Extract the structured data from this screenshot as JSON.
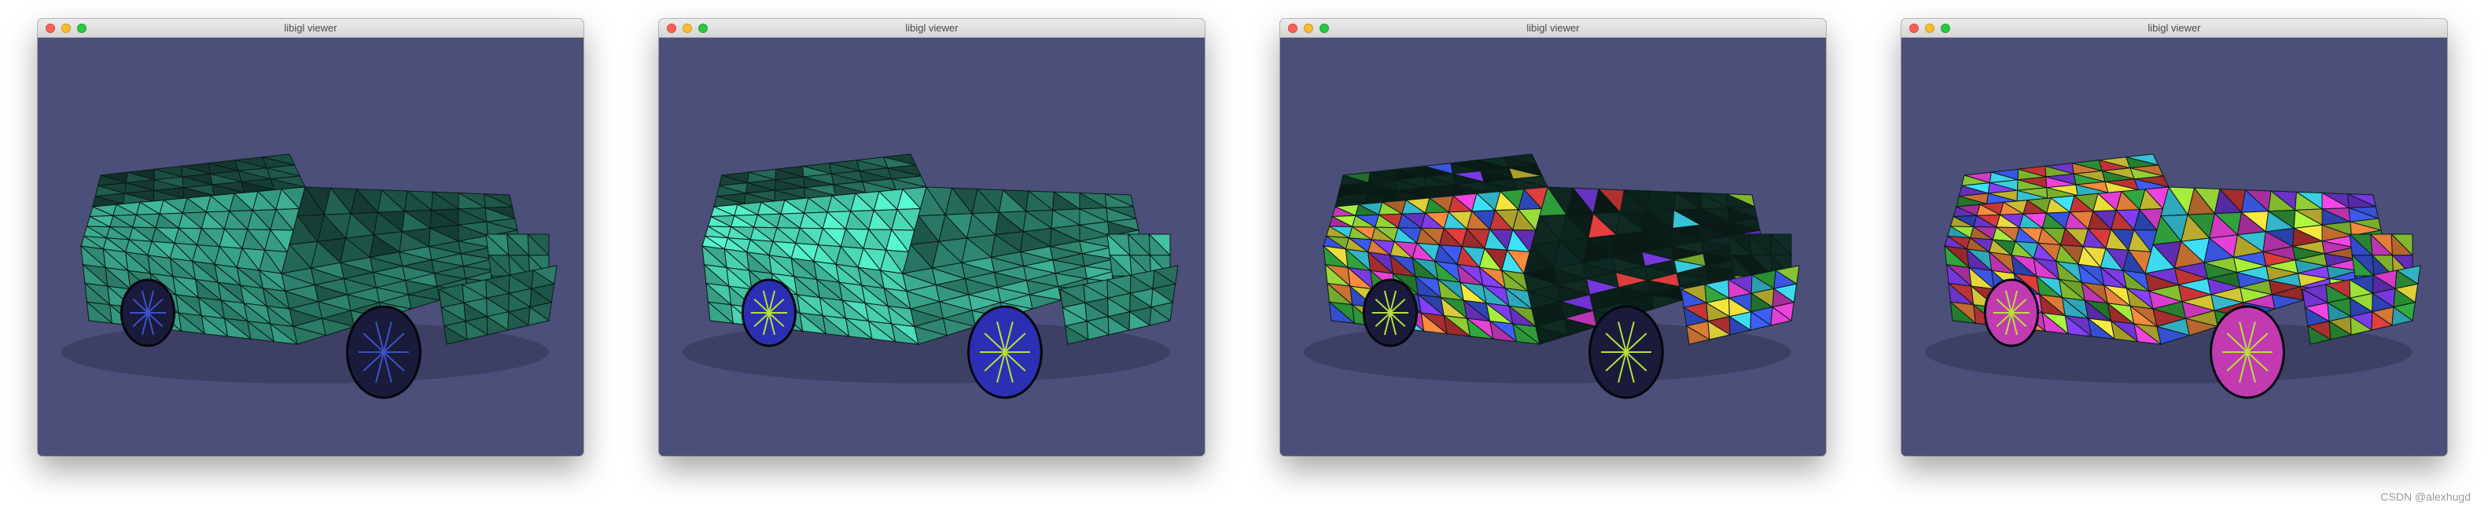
{
  "windows": [
    {
      "title": "libigl viewer",
      "shading": "teal"
    },
    {
      "title": "libigl viewer",
      "shading": "teal-lit"
    },
    {
      "title": "libigl viewer",
      "shading": "random-partial"
    },
    {
      "title": "libigl viewer",
      "shading": "random-full"
    }
  ],
  "colors": {
    "background": "#4b4f7a",
    "close": "#fe5f57",
    "minimize": "#febc2e",
    "zoom": "#28c840",
    "teal": "#46c9a9",
    "face_palette": [
      "#e23fd4",
      "#3a57e6",
      "#9fe23a",
      "#d43a3a",
      "#3ad0e6",
      "#e6d63a",
      "#7b3ae6",
      "#2f9b3a",
      "#e6813a"
    ]
  },
  "watermark": "CSDN @alexhugd"
}
